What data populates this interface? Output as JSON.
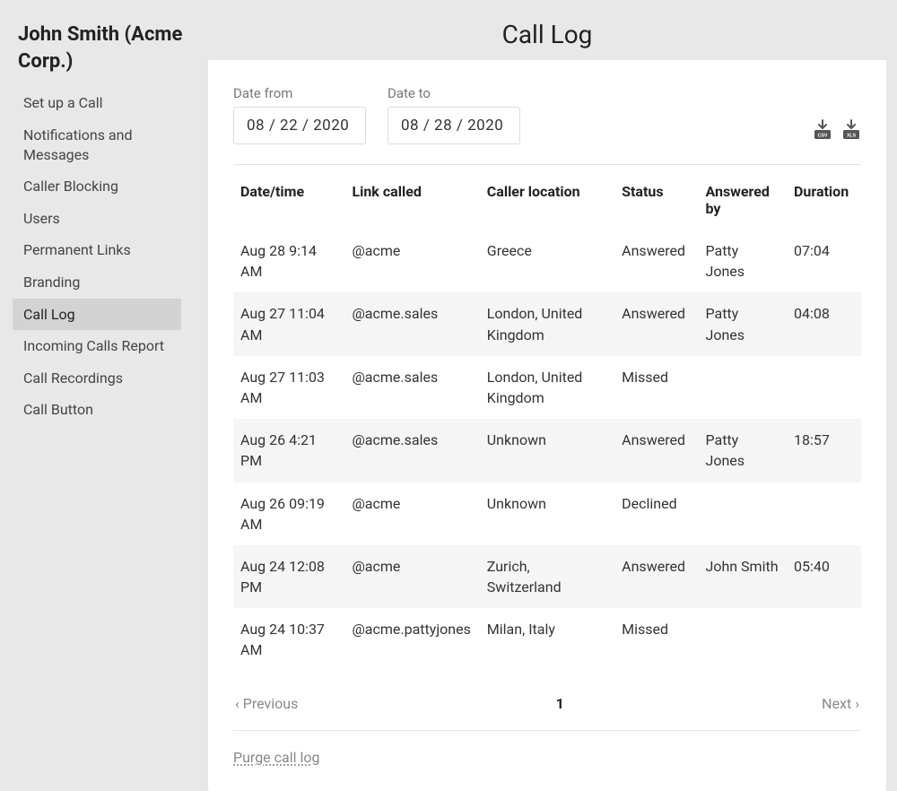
{
  "sidebar": {
    "title": "John Smith (Acme Corp.)",
    "items": [
      {
        "label": "Set up a Call",
        "active": false
      },
      {
        "label": "Notifications and Messages",
        "active": false
      },
      {
        "label": "Caller Blocking",
        "active": false
      },
      {
        "label": "Users",
        "active": false
      },
      {
        "label": "Permanent Links",
        "active": false
      },
      {
        "label": "Branding",
        "active": false
      },
      {
        "label": "Call Log",
        "active": true
      },
      {
        "label": "Incoming Calls Report",
        "active": false
      },
      {
        "label": "Call Recordings",
        "active": false
      },
      {
        "label": "Call Button",
        "active": false
      }
    ]
  },
  "page": {
    "title": "Call Log"
  },
  "filters": {
    "date_from_label": "Date from",
    "date_from_value": "08 / 22 / 2020",
    "date_to_label": "Date to",
    "date_to_value": "08 / 28 / 2020"
  },
  "download": {
    "csv_label": "CSV",
    "xls_label": "XLS"
  },
  "table": {
    "headers": {
      "datetime": "Date/time",
      "link": "Link called",
      "location": "Caller location",
      "status": "Status",
      "answered_by": "Answered by",
      "duration": "Duration"
    },
    "rows": [
      {
        "datetime": "Aug 28 9:14 AM",
        "link": "@acme",
        "location": "Greece",
        "status": "Answered",
        "answered_by": "Patty Jones",
        "duration": "07:04"
      },
      {
        "datetime": "Aug 27 11:04 AM",
        "link": "@acme.sales",
        "location": "London, United Kingdom",
        "status": "Answered",
        "answered_by": "Patty Jones",
        "duration": "04:08"
      },
      {
        "datetime": "Aug 27 11:03 AM",
        "link": "@acme.sales",
        "location": "London, United Kingdom",
        "status": "Missed",
        "answered_by": "",
        "duration": ""
      },
      {
        "datetime": "Aug 26 4:21 PM",
        "link": "@acme.sales",
        "location": "Unknown",
        "status": "Answered",
        "answered_by": "Patty Jones",
        "duration": "18:57"
      },
      {
        "datetime": "Aug 26 09:19 AM",
        "link": "@acme",
        "location": "Unknown",
        "status": "Declined",
        "answered_by": "",
        "duration": ""
      },
      {
        "datetime": "Aug 24 12:08 PM",
        "link": "@acme",
        "location": "Zurich, Switzerland",
        "status": "Answered",
        "answered_by": "John Smith",
        "duration": "05:40"
      },
      {
        "datetime": "Aug 24 10:37 AM",
        "link": "@acme.pattyjones",
        "location": "Milan, Italy",
        "status": "Missed",
        "answered_by": "",
        "duration": ""
      }
    ]
  },
  "pagination": {
    "prev": "‹ Previous",
    "page": "1",
    "next": "Next ›"
  },
  "actions": {
    "purge": "Purge call log"
  }
}
